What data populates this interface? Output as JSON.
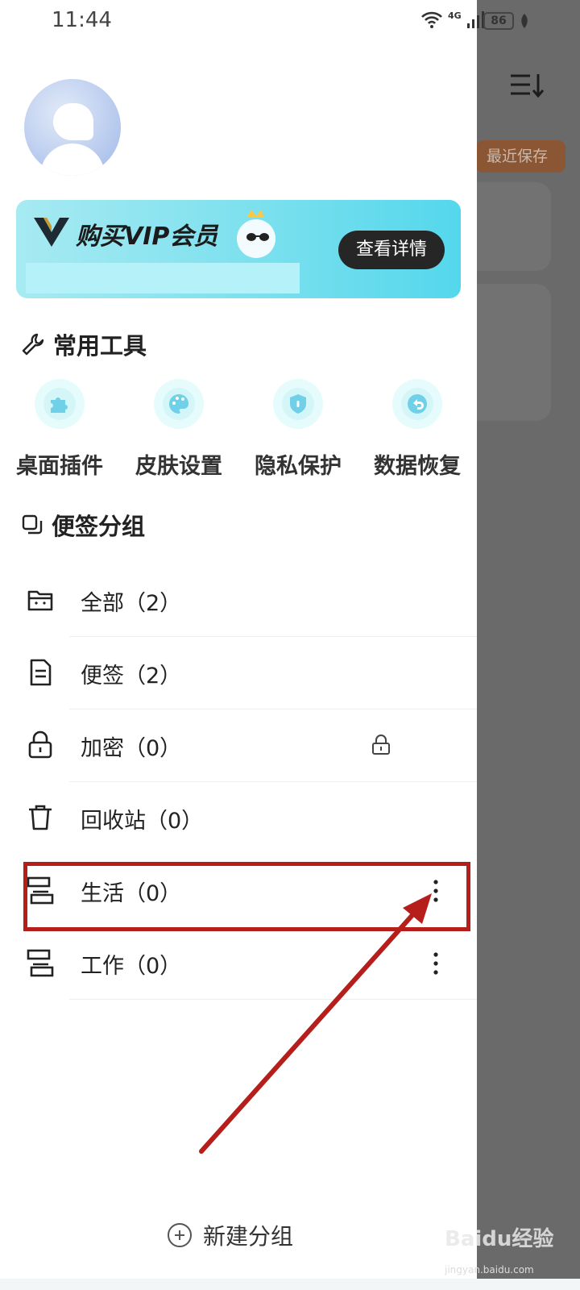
{
  "statusbar": {
    "time": "11:44",
    "network": "4G",
    "battery": "86"
  },
  "background_app": {
    "recent_saved_chip": "最近保存"
  },
  "vip_banner": {
    "title": "购买VIP会员",
    "button": "查看详情"
  },
  "tools_section": {
    "title": "常用工具",
    "items": [
      {
        "label": "桌面插件",
        "icon": "puzzle-icon"
      },
      {
        "label": "皮肤设置",
        "icon": "palette-icon"
      },
      {
        "label": "隐私保护",
        "icon": "shield-icon"
      },
      {
        "label": "数据恢复",
        "icon": "restore-icon"
      }
    ]
  },
  "groups_section": {
    "title": "便签分组",
    "items": [
      {
        "label": "全部（2）",
        "icon": "folder-icon"
      },
      {
        "label": "便签（2）",
        "icon": "note-icon"
      },
      {
        "label": "加密（0）",
        "icon": "lock-icon"
      },
      {
        "label": "回收站（0）",
        "icon": "trash-icon"
      },
      {
        "label": "生活（0）",
        "icon": "group-icon"
      },
      {
        "label": "工作（0）",
        "icon": "group-icon"
      }
    ]
  },
  "new_group": {
    "label": "新建分组"
  },
  "watermark": {
    "text": "Baidu经验",
    "sub": "jingyan.baidu.com"
  },
  "colors": {
    "highlight": "#b51e1b",
    "vip_gradient_end": "#54d7ec",
    "overlay": "#6a6a6a"
  }
}
